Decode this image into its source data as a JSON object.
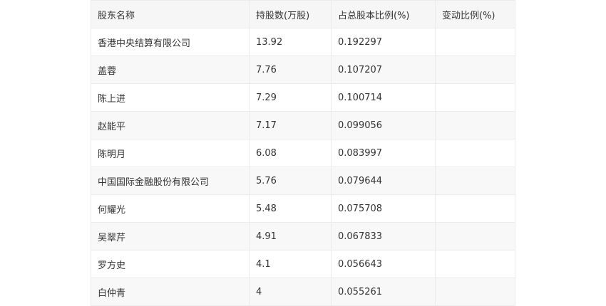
{
  "table": {
    "headers": [
      "股东名称",
      "持股数(万股)",
      "占总股本比例(%)",
      "变动比例(%)"
    ],
    "rows": [
      [
        "香港中央结算有限公司",
        "13.92",
        "0.192297",
        ""
      ],
      [
        "盖蓉",
        "7.76",
        "0.107207",
        ""
      ],
      [
        "陈上进",
        "7.29",
        "0.100714",
        ""
      ],
      [
        "赵能平",
        "7.17",
        "0.099056",
        ""
      ],
      [
        "陈明月",
        "6.08",
        "0.083997",
        ""
      ],
      [
        "中国国际金融股份有限公司",
        "5.76",
        "0.079644",
        ""
      ],
      [
        "何耀光",
        "5.48",
        "0.075708",
        ""
      ],
      [
        "吴翠芹",
        "4.91",
        "0.067833",
        ""
      ],
      [
        "罗方史",
        "4.1",
        "0.056643",
        ""
      ],
      [
        "白仲青",
        "4",
        "0.055261",
        ""
      ]
    ]
  }
}
